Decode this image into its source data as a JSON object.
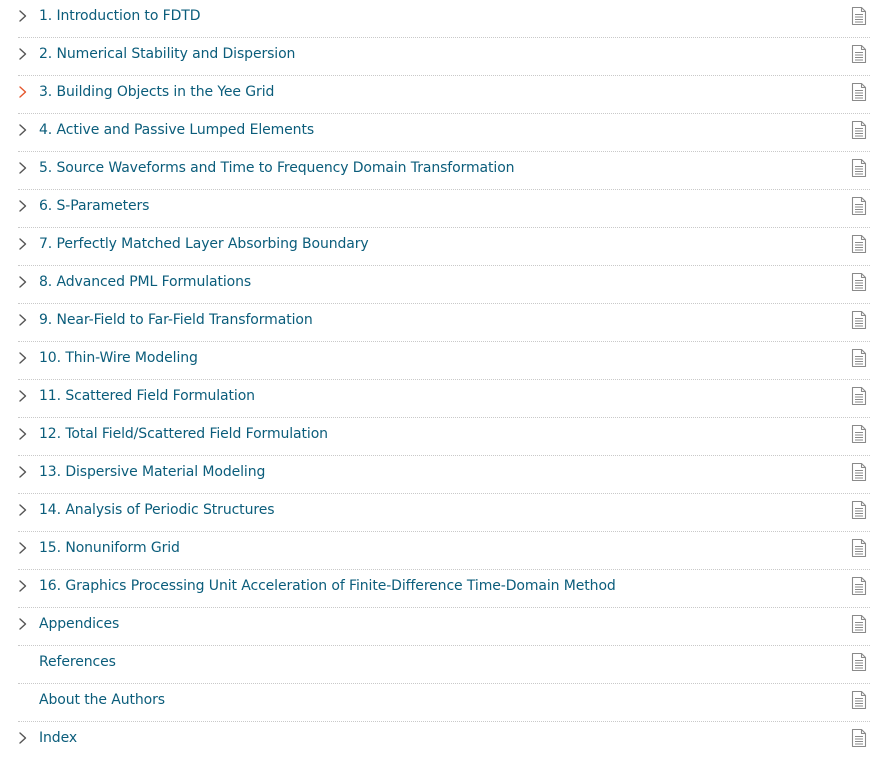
{
  "toc": {
    "items": [
      {
        "label": "1. Introduction to FDTD",
        "expandable": true,
        "active": false
      },
      {
        "label": "2. Numerical Stability and Dispersion",
        "expandable": true,
        "active": false
      },
      {
        "label": "3. Building Objects in the Yee Grid",
        "expandable": true,
        "active": true
      },
      {
        "label": "4. Active and Passive Lumped Elements",
        "expandable": true,
        "active": false
      },
      {
        "label": "5. Source Waveforms and Time to Frequency Domain Transformation",
        "expandable": true,
        "active": false
      },
      {
        "label": "6. S-Parameters",
        "expandable": true,
        "active": false
      },
      {
        "label": "7. Perfectly Matched Layer Absorbing Boundary",
        "expandable": true,
        "active": false
      },
      {
        "label": "8. Advanced PML Formulations",
        "expandable": true,
        "active": false
      },
      {
        "label": "9. Near-Field to Far-Field Transformation",
        "expandable": true,
        "active": false
      },
      {
        "label": "10. Thin-Wire Modeling",
        "expandable": true,
        "active": false
      },
      {
        "label": "11. Scattered Field Formulation",
        "expandable": true,
        "active": false
      },
      {
        "label": "12. Total Field/Scattered Field Formulation",
        "expandable": true,
        "active": false
      },
      {
        "label": "13. Dispersive Material Modeling",
        "expandable": true,
        "active": false
      },
      {
        "label": "14. Analysis of Periodic Structures",
        "expandable": true,
        "active": false
      },
      {
        "label": "15. Nonuniform Grid",
        "expandable": true,
        "active": false
      },
      {
        "label": "16. Graphics Processing Unit Acceleration of Finite-Difference Time-Domain Method",
        "expandable": true,
        "active": false
      },
      {
        "label": "Appendices",
        "expandable": true,
        "active": false
      },
      {
        "label": "References",
        "expandable": false,
        "active": false
      },
      {
        "label": "About the Authors",
        "expandable": false,
        "active": false
      },
      {
        "label": "Index",
        "expandable": true,
        "active": false
      }
    ],
    "row_icon": "pdf-document-icon",
    "expand_icon": "chevron-right-icon"
  },
  "colors": {
    "link": "#0b5d7b",
    "chevron": "#555555",
    "chevron_active": "#e4572e",
    "icon": "#8a8a8a",
    "separator": "#c9c9c9"
  }
}
